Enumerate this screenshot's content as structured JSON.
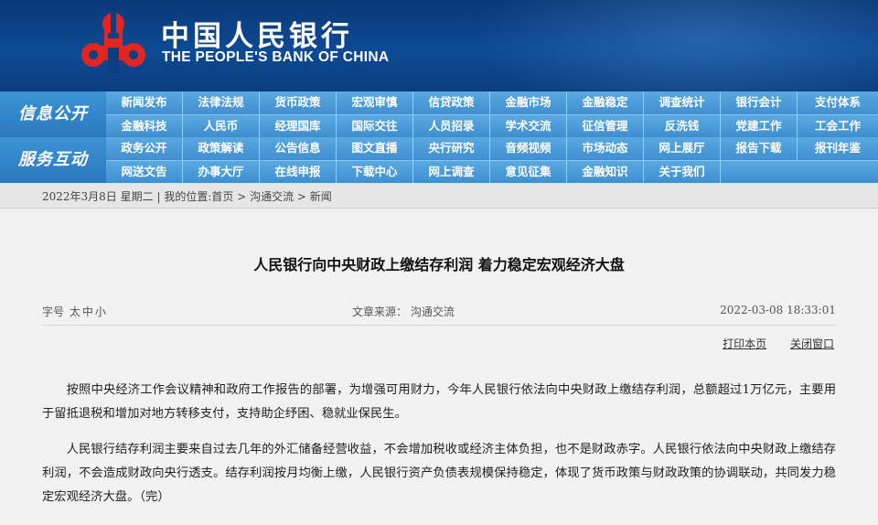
{
  "header": {
    "logo_cn": "中国人民银行",
    "logo_en": "THE PEOPLE'S BANK OF CHINA",
    "emblem_icon": "pboc-emblem-icon",
    "colors": {
      "background": "#0b3f82",
      "emblem": "#e32521",
      "nav": "#4a9ad8"
    }
  },
  "nav": {
    "info": {
      "label": "信息公开",
      "row1": [
        "新闻发布",
        "法律法规",
        "货币政策",
        "宏观审慎",
        "信贷政策",
        "金融市场",
        "金融稳定",
        "调查统计",
        "银行会计",
        "支付体系"
      ],
      "row2": [
        "金融科技",
        "人民币",
        "经理国库",
        "国际交往",
        "人员招录",
        "学术交流",
        "征信管理",
        "反洗钱",
        "党建工作",
        "工会工作"
      ]
    },
    "service": {
      "label": "服务互动",
      "row1": [
        "政务公开",
        "政策解读",
        "公告信息",
        "图文直播",
        "央行研究",
        "音频视频",
        "市场动态",
        "网上展厅",
        "报告下载",
        "报刊年鉴"
      ],
      "row2": [
        "网送文告",
        "办事大厅",
        "在线申报",
        "下载中心",
        "网上调查",
        "意见征集",
        "金融知识",
        "关于我们"
      ]
    }
  },
  "breadcrumb": {
    "date": "2022年3月8日 星期二",
    "prefix": "我的位置:",
    "home": "首页",
    "section": "沟通交流",
    "current": "新闻",
    "sep": " > "
  },
  "article": {
    "title": "人民银行向中央财政上缴结存利润 着力稳定宏观经济大盘",
    "font_size_label": "字号",
    "font_sizes": [
      "太",
      "中",
      "小"
    ],
    "source": "文章来源：  沟通交流",
    "datetime": "2022-03-08 18:33:01",
    "print_label": "打印本页",
    "close_label": "关闭窗口",
    "paragraphs": [
      "按照中央经济工作会议精神和政府工作报告的部署，为增强可用财力，今年人民银行依法向中央财政上缴结存利润，总额超过1万亿元，主要用于留抵退税和增加对地方转移支付，支持助企纾困、稳就业保民生。",
      "人民银行结存利润主要来自过去几年的外汇储备经营收益，不会增加税收或经济主体负担，也不是财政赤字。人民银行依法向中央财政上缴结存利润，不会造成财政向央行透支。结存利润按月均衡上缴，人民银行资产负债表规模保持稳定，体现了货币政策与财政政策的协调联动，共同发力稳定宏观经济大盘。（完）"
    ]
  }
}
